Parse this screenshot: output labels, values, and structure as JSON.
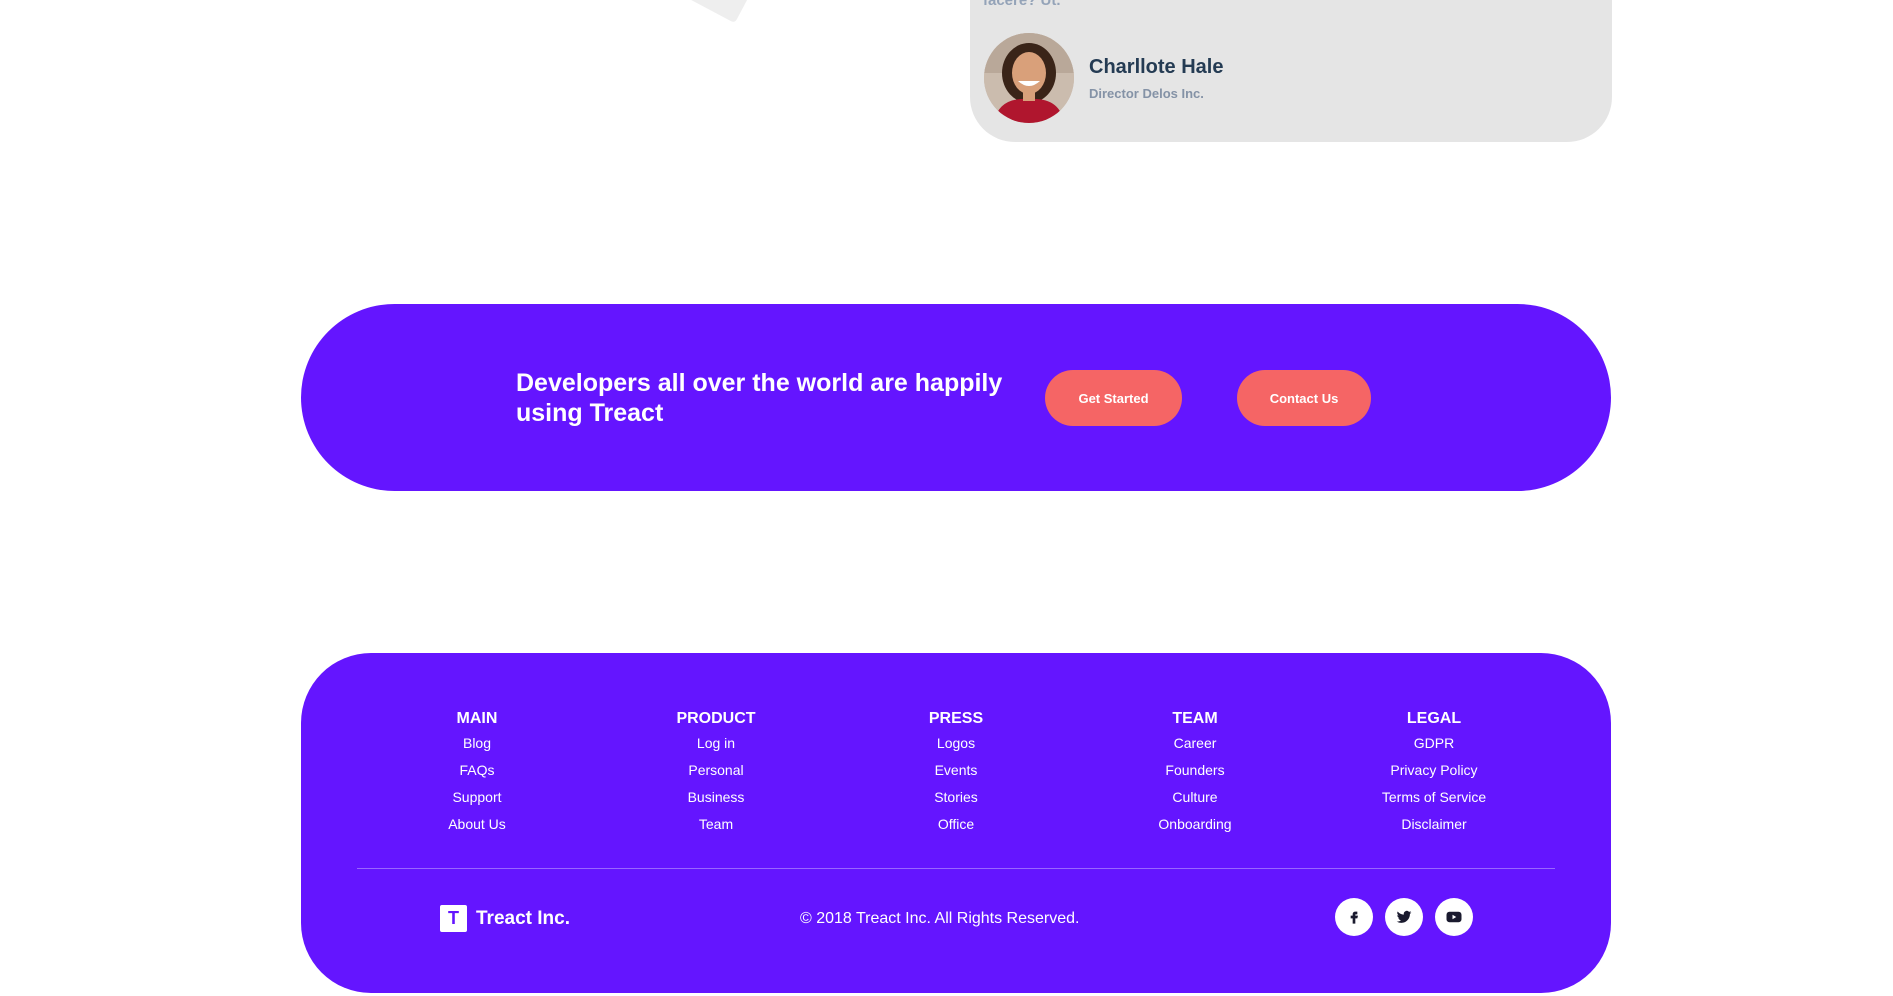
{
  "testimonial": {
    "quote_tail": "facere? Ut.",
    "author_name": "Charllote Hale",
    "author_title": "Director Delos Inc."
  },
  "cta": {
    "text": "Developers all over the world are happily using Treact",
    "primary_label": "Get Started",
    "secondary_label": "Contact Us"
  },
  "footer": {
    "columns": [
      {
        "heading": "MAIN",
        "links": [
          "Blog",
          "FAQs",
          "Support",
          "About Us"
        ]
      },
      {
        "heading": "PRODUCT",
        "links": [
          "Log in",
          "Personal",
          "Business",
          "Team"
        ]
      },
      {
        "heading": "PRESS",
        "links": [
          "Logos",
          "Events",
          "Stories",
          "Office"
        ]
      },
      {
        "heading": "TEAM",
        "links": [
          "Career",
          "Founders",
          "Culture",
          "Onboarding"
        ]
      },
      {
        "heading": "LEGAL",
        "links": [
          "GDPR",
          "Privacy Policy",
          "Terms of Service",
          "Disclaimer"
        ]
      }
    ],
    "brand_letter": "T",
    "brand_name": "Treact Inc.",
    "copyright": "© 2018 Treact Inc. All Rights Reserved.",
    "social": [
      "facebook-icon",
      "twitter-icon",
      "youtube-icon"
    ]
  },
  "colors": {
    "primary": "#6415ff",
    "accent": "#f56565",
    "card_bg": "#e5e5e5"
  }
}
